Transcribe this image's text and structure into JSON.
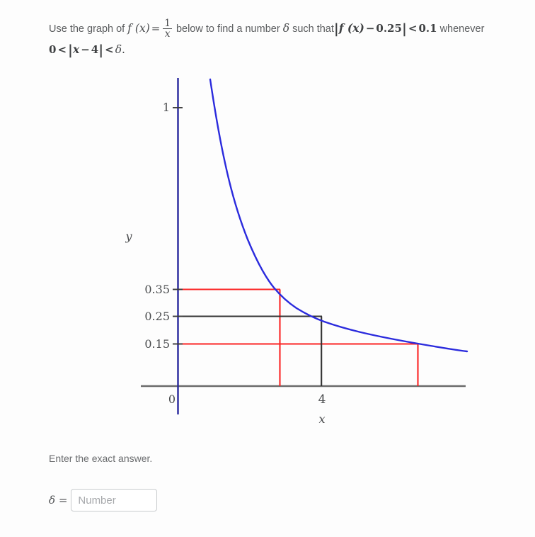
{
  "problem": {
    "lead": "Use the graph of",
    "f_of_x": "f (x)",
    "equals": "=",
    "fraction_num": "1",
    "fraction_den": "x",
    "mid": "below to find a number",
    "delta": "δ",
    "such_that": "such that",
    "abs_open": "|",
    "f_of_x2": "f (x)",
    "minus": "−",
    "value_025": "0.25",
    "abs_close": "|",
    "lt1": "<",
    "value_01": "0.1",
    "whenever": "whenever",
    "line2_zero": "0",
    "line2_lt1": "<",
    "line2_abs_open": "|",
    "line2_x": "x",
    "line2_minus": "−",
    "line2_four": "4",
    "line2_abs_close": "|",
    "line2_lt2": "<",
    "line2_delta": "δ",
    "line2_period": "."
  },
  "footer": {
    "note": "Enter the exact answer.",
    "delta_symbol": "δ",
    "equals": "=",
    "input_value": "",
    "input_placeholder": "Number"
  },
  "chart_data": {
    "type": "line",
    "title": "",
    "xlabel": "x",
    "ylabel": "y",
    "function": "f(x) = 1/x",
    "curve_color": "#2b2bdd",
    "axis_color": "#6b6b6b",
    "y_axis_color": "#25259c",
    "guide_color_primary": "#333333",
    "guide_color_tolerance": "#fb2424",
    "x_ticks": [
      {
        "label": "4",
        "value": 4
      }
    ],
    "y_ticks": [
      {
        "label": "1",
        "value": 1
      },
      {
        "label": "0.35",
        "value": 0.35
      },
      {
        "label": "0.25",
        "value": 0.25
      },
      {
        "label": "0.15",
        "value": 0.15
      }
    ],
    "origin_label": "0",
    "xlim": [
      0,
      7.4
    ],
    "ylim": [
      0,
      1.23
    ],
    "grid": false,
    "legend": false,
    "annotations": [
      {
        "name": "center-point",
        "x": 4,
        "y": 0.25,
        "color": "#333333"
      },
      {
        "name": "upper-tolerance-point",
        "x": 2.857,
        "y": 0.35,
        "color": "#fb2424"
      },
      {
        "name": "lower-tolerance-point",
        "x": 6.667,
        "y": 0.15,
        "color": "#fb2424"
      }
    ],
    "series": [
      {
        "name": "f(x) = 1/x",
        "color": "#2b2bdd",
        "x": [
          0.815,
          0.9,
          1.0,
          1.15,
          1.3,
          1.5,
          1.75,
          2.0,
          2.25,
          2.5,
          2.857,
          3.2,
          3.6,
          4.0,
          4.5,
          5.0,
          5.6,
          6.2,
          6.667,
          7.0,
          7.35
        ],
        "y": [
          1.227,
          1.111,
          1.0,
          0.87,
          0.769,
          0.667,
          0.571,
          0.5,
          0.444,
          0.4,
          0.35,
          0.3125,
          0.278,
          0.25,
          0.222,
          0.2,
          0.179,
          0.161,
          0.15,
          0.143,
          0.136
        ]
      }
    ]
  }
}
